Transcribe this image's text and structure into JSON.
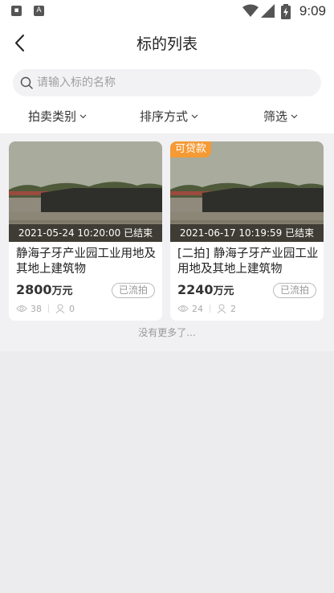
{
  "status_bar": {
    "time": "9:09",
    "icons": [
      "app-icon",
      "a-icon",
      "wifi-icon",
      "signal-icon",
      "battery-icon"
    ]
  },
  "header": {
    "title": "标的列表",
    "back_icon": "chevron-left-icon"
  },
  "search": {
    "placeholder": "请输入标的名称",
    "value": ""
  },
  "filters": [
    {
      "label": "拍卖类别"
    },
    {
      "label": "排序方式"
    },
    {
      "label": "筛选"
    }
  ],
  "items": [
    {
      "badge": "",
      "datetime": "2021-05-24 10:20:00 已结束",
      "title": "静海子牙产业园工业用地及其地上建筑物",
      "price": "2800",
      "price_unit": "万元",
      "status": "已流拍",
      "views": "38",
      "watchers": "0"
    },
    {
      "badge": "可贷款",
      "datetime": "2021-06-17 10:19:59 已结束",
      "title": "[二拍] 静海子牙产业园工业用地及其地上建筑物",
      "price": "2240",
      "price_unit": "万元",
      "status": "已流拍",
      "views": "24",
      "watchers": "2"
    }
  ],
  "list_end_text": "没有更多了...",
  "colors": {
    "accent": "#f59a34",
    "background": "#f1f1f3"
  }
}
